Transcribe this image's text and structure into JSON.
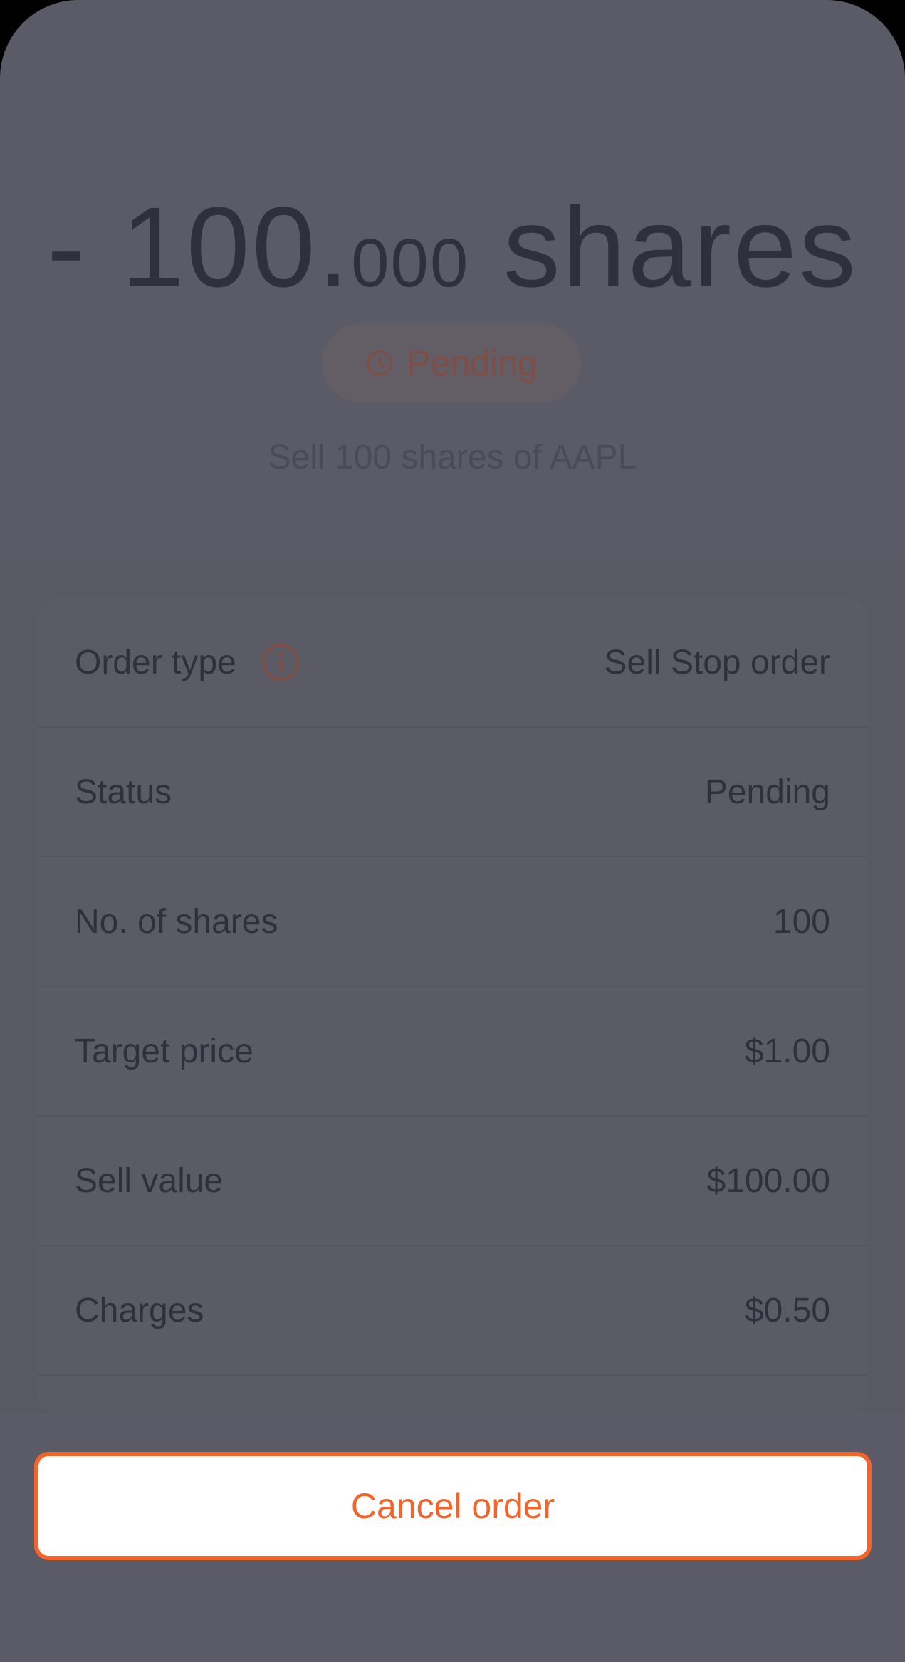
{
  "header": {
    "amount_main": "- 100.",
    "amount_decimals": "000",
    "amount_unit": " shares",
    "status_badge": {
      "icon": "clock-icon",
      "label": "Pending",
      "color": "#7f4e44"
    },
    "subtitle": "Sell 100 shares of AAPL"
  },
  "details": {
    "rows": [
      {
        "label": "Order type",
        "value": "Sell Stop order",
        "icon": "info-icon"
      },
      {
        "label": "Status",
        "value": "Pending"
      },
      {
        "label": "No. of shares",
        "value": "100"
      },
      {
        "label": "Target price",
        "value": "$1.00"
      },
      {
        "label": "Sell value",
        "value": "$100.00"
      },
      {
        "label": "Charges",
        "value": "$0.50"
      }
    ]
  },
  "footer": {
    "cancel_label": "Cancel order",
    "accent_color": "#f3632a"
  }
}
